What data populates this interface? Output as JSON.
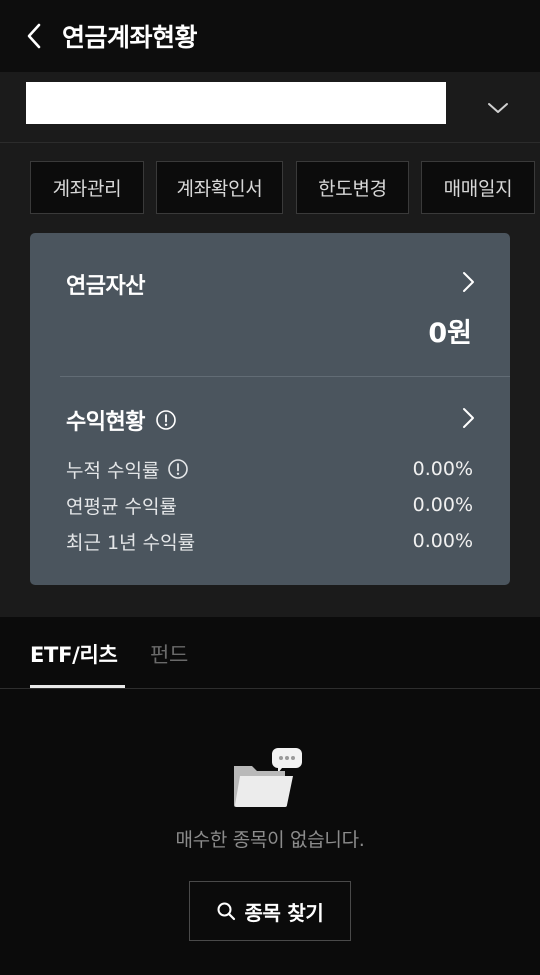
{
  "header": {
    "title": "연금계좌현황",
    "back_icon": "chevron-left-icon"
  },
  "account": {
    "selected": "",
    "dropdown_icon": "chevron-down-icon"
  },
  "quick_actions": [
    {
      "label": "계좌관리"
    },
    {
      "label": "계좌확인서"
    },
    {
      "label": "한도변경"
    },
    {
      "label": "매매일지"
    }
  ],
  "asset_card": {
    "title": "연금자산",
    "value": "0원",
    "returns_title": "수익현황",
    "rows": [
      {
        "label": "누적 수익률",
        "value": "0.00%"
      },
      {
        "label": "연평균 수익률",
        "value": "0.00%"
      },
      {
        "label": "최근 1년 수익률",
        "value": "0.00%"
      }
    ]
  },
  "tabs": [
    {
      "label": "ETF/리츠",
      "active": true
    },
    {
      "label": "펀드",
      "active": false
    }
  ],
  "empty_state": {
    "message": "매수한 종목이 없습니다.",
    "button_label": "종목 찾기",
    "icon": "folder-chat-icon"
  },
  "colors": {
    "background": "#0b0b0b",
    "section": "#1b1b1b",
    "card": "#4b555e",
    "inactive_tab": "#6a6a6a"
  }
}
